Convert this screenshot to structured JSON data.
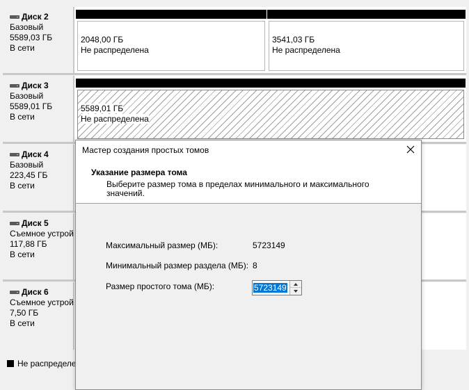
{
  "disks": [
    {
      "name": "Диск 2",
      "type": "Базовый",
      "size": "5589,03 ГБ",
      "status": "В сети",
      "partitions": [
        {
          "size": "2048,00 ГБ",
          "status": "Не распределена"
        },
        {
          "size": "3541,03 ГБ",
          "status": "Не распределена"
        }
      ]
    },
    {
      "name": "Диск 3",
      "type": "Базовый",
      "size": "5589,01 ГБ",
      "status": "В сети",
      "partitions": [
        {
          "size": "5589,01 ГБ",
          "status": "Не распределена"
        }
      ]
    },
    {
      "name": "Диск 4",
      "type": "Базовый",
      "size": "223,45 ГБ",
      "status": "В сети"
    },
    {
      "name": "Диск 5",
      "type": "Съемное устрой",
      "size": "117,88 ГБ",
      "status": "В сети"
    },
    {
      "name": "Диск 6",
      "type": "Съемное устрой",
      "size": "7,50 ГБ",
      "status": "В сети"
    }
  ],
  "legend": {
    "unallocated": "Не распределе"
  },
  "wizard": {
    "title": "Мастер создания простых томов",
    "heading": "Указание размера тома",
    "description": "Выберите размер тома в пределах минимального и максимального значений.",
    "max_label": "Максимальный размер (МБ):",
    "max_value": "5723149",
    "min_label": "Минимальный размер раздела (МБ):",
    "min_value": "8",
    "size_label": "Размер простого тома (МБ):",
    "size_value": "5723149"
  }
}
